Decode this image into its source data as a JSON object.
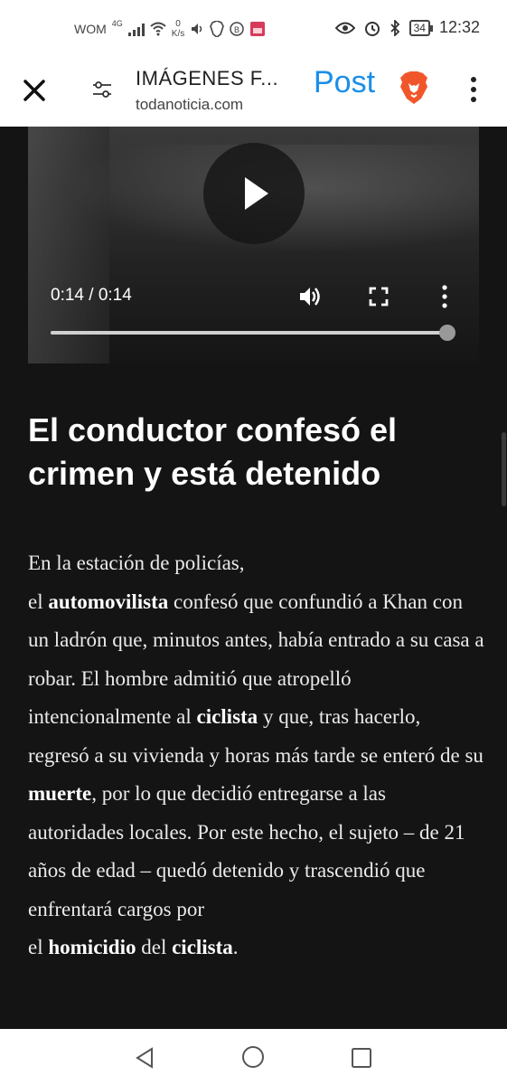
{
  "status_bar": {
    "carrier": "WOM",
    "network": "4G",
    "speed_value": "0",
    "speed_unit": "K/s",
    "battery": "34",
    "time": "12:32"
  },
  "app_bar": {
    "title": "IMÁGENES F...",
    "domain": "todanoticia.com",
    "post_label": "Post"
  },
  "video": {
    "time": "0:14 / 0:14",
    "progress": 1.0
  },
  "article": {
    "heading": "El conductor confesó el crimen y está detenido",
    "p1": "En la estación de policías,",
    "p2a": "el ",
    "b1": "automovilista",
    "p2b": " confesó que confundió a Khan con un ladrón que, minutos antes, había entrado a su casa a robar. El hombre admitió que atropelló intencionalmente al ",
    "b2": "ciclista",
    "p2c": " y que, tras hacerlo, regresó a su vivienda y horas más tarde se enteró de su ",
    "b3": "muerte",
    "p2d": ", por lo que decidió entregarse a las autoridades locales. Por este hecho, el sujeto – de 21 años de edad – quedó detenido y trascendió que enfrentará cargos por",
    "p3a": "el ",
    "b4": "homicidio",
    "p3b": " del ",
    "b5": "ciclista",
    "p3c": "."
  },
  "colors": {
    "accent": "#1a8ee8",
    "brave": "#f1562b",
    "background": "#141414"
  },
  "icons": [
    "close-icon",
    "tune-icon",
    "brave-lion-icon",
    "more-vert-icon",
    "play-icon",
    "volume-icon",
    "fullscreen-icon",
    "back-icon",
    "home-icon",
    "recents-icon"
  ]
}
